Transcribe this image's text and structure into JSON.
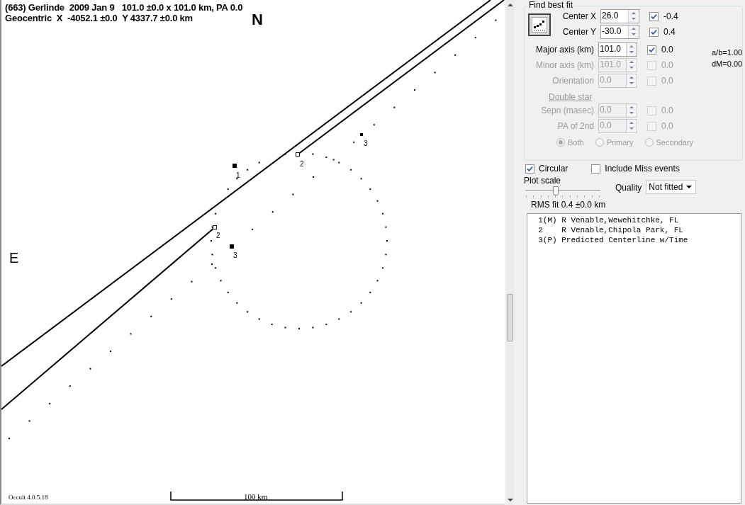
{
  "plot": {
    "header": [
      "(663) Gerlinde  2009 Jan 9   101.0 ±0.0 x 101.0 km, PA 0.0",
      "Geocentric  X  -4052.1 ±0.0  Y 4337.7 ±0.0 km"
    ],
    "north_label": "N",
    "east_label": "E",
    "markers": [
      {
        "label": "1",
        "kind": "filled"
      },
      {
        "label": "2",
        "kind": "open"
      },
      {
        "label": "2",
        "kind": "open"
      },
      {
        "label": "3",
        "kind": "filled"
      },
      {
        "label": "3",
        "kind": "dot"
      }
    ],
    "version": "Occult 4.0.5.18",
    "scale_label": "100 km"
  },
  "fit_panel": {
    "title": "Find best fit",
    "fields": [
      {
        "label": "Center X",
        "value": "26.0",
        "checked": true,
        "disabled": false,
        "result": "-0.4"
      },
      {
        "label": "Center Y",
        "value": "-30.0",
        "checked": true,
        "disabled": false,
        "result": "0.4"
      },
      {
        "label": "Major axis (km)",
        "value": "101.0",
        "checked": true,
        "disabled": false,
        "result": "0.0",
        "note": "a/b=1.00"
      },
      {
        "label": "Minor axis (km)",
        "value": "101.0",
        "checked": false,
        "disabled": true,
        "result": "0.0",
        "note": "dM=0.00"
      },
      {
        "label": "Orientation",
        "value": "0.0",
        "checked": false,
        "disabled": true,
        "result": "0.0"
      }
    ],
    "double_star": {
      "link": "Double star",
      "disabled": true,
      "fields": [
        {
          "label": "Sepn (masec)",
          "value": "0.0",
          "checked": false,
          "disabled": true,
          "result": "0.0"
        },
        {
          "label": "PA of 2nd",
          "value": "0.0",
          "checked": false,
          "disabled": true,
          "result": "0.0"
        }
      ],
      "options": [
        {
          "label": "Both",
          "selected": true
        },
        {
          "label": "Primary",
          "selected": false
        },
        {
          "label": "Secondary",
          "selected": false
        }
      ]
    }
  },
  "circular": {
    "label": "Circular",
    "checked": true
  },
  "include_miss": {
    "label": "Include Miss events",
    "checked": false
  },
  "plot_scale": {
    "label": "Plot scale",
    "level": 0.4
  },
  "quality": {
    "label": "Quality",
    "value": "Not fitted"
  },
  "rms": "RMS fit 0.4 ±0.0 km",
  "observers": [
    "  1(M) R Venable,Wewehitchke, FL",
    "  2    R Venable,Chipola Park, FL",
    "  3(P) Predicted Centerline w/Time"
  ]
}
